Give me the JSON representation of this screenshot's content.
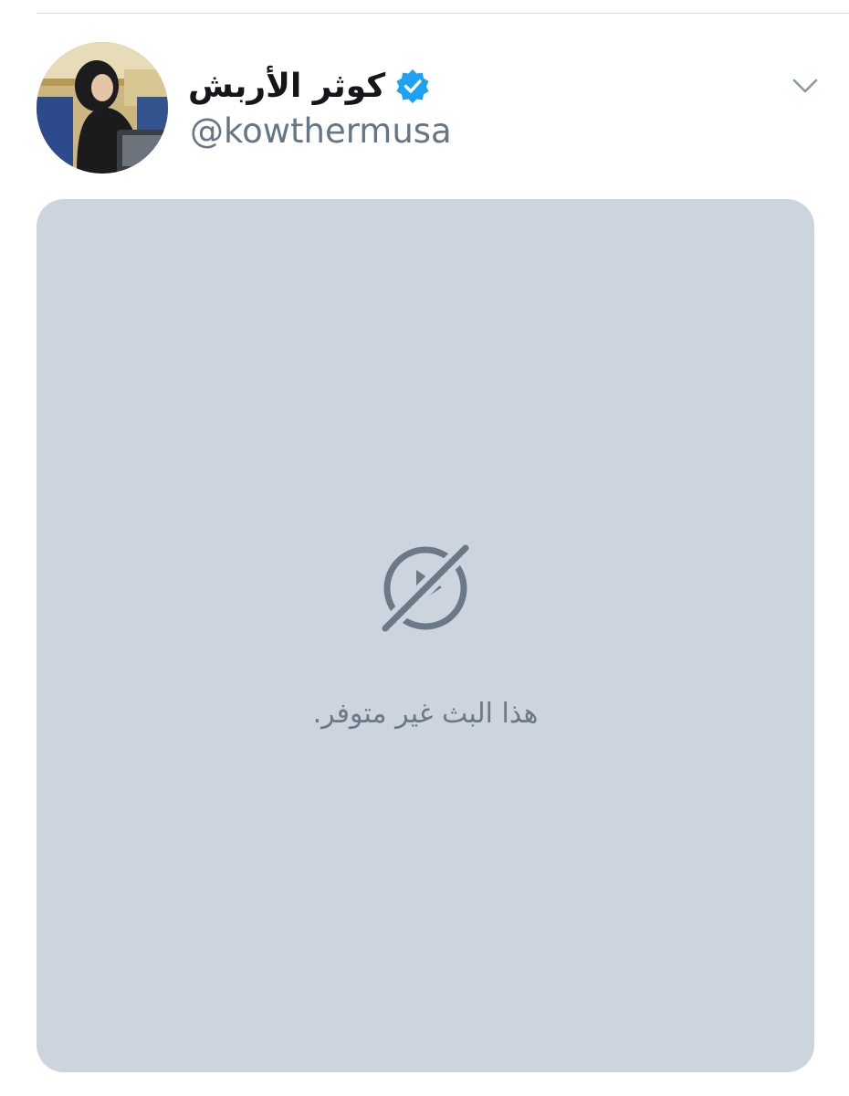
{
  "tweet": {
    "author": {
      "display_name": "كوثر الأربش",
      "handle": "@kowthermusa",
      "verified": true,
      "avatar_icon": "profile-photo"
    },
    "menu_icon": "chevron-down-icon"
  },
  "media": {
    "status_icon": "broadcast-unavailable-icon",
    "message": "هذا البث غير متوفر."
  },
  "colors": {
    "verified_badge": "#1da1f2",
    "media_background": "#ccd5de",
    "secondary_text": "#657786",
    "icon_gray": "#6b7886"
  }
}
